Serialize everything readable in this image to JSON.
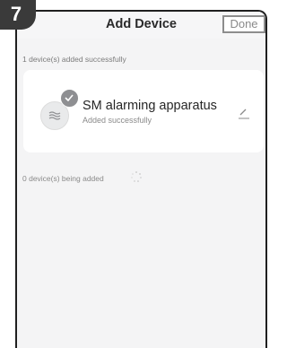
{
  "step": {
    "number": "7"
  },
  "header": {
    "title": "Add Device",
    "done_label": "Done"
  },
  "added": {
    "summary": "1 device(s) added successfully",
    "devices": [
      {
        "name": "SM alarming apparatus",
        "status": "Added successfully",
        "icon": "alarm-device-icon",
        "badge_icon": "check-icon",
        "action_icon": "edit-icon"
      }
    ]
  },
  "adding": {
    "summary": "0 device(s) being added",
    "indicator_icon": "loading-spinner-icon"
  },
  "colors": {
    "background": "#f4f4f5",
    "card": "#ffffff",
    "badge": "#8e8f92",
    "step_badge": "#3a3a3a"
  }
}
